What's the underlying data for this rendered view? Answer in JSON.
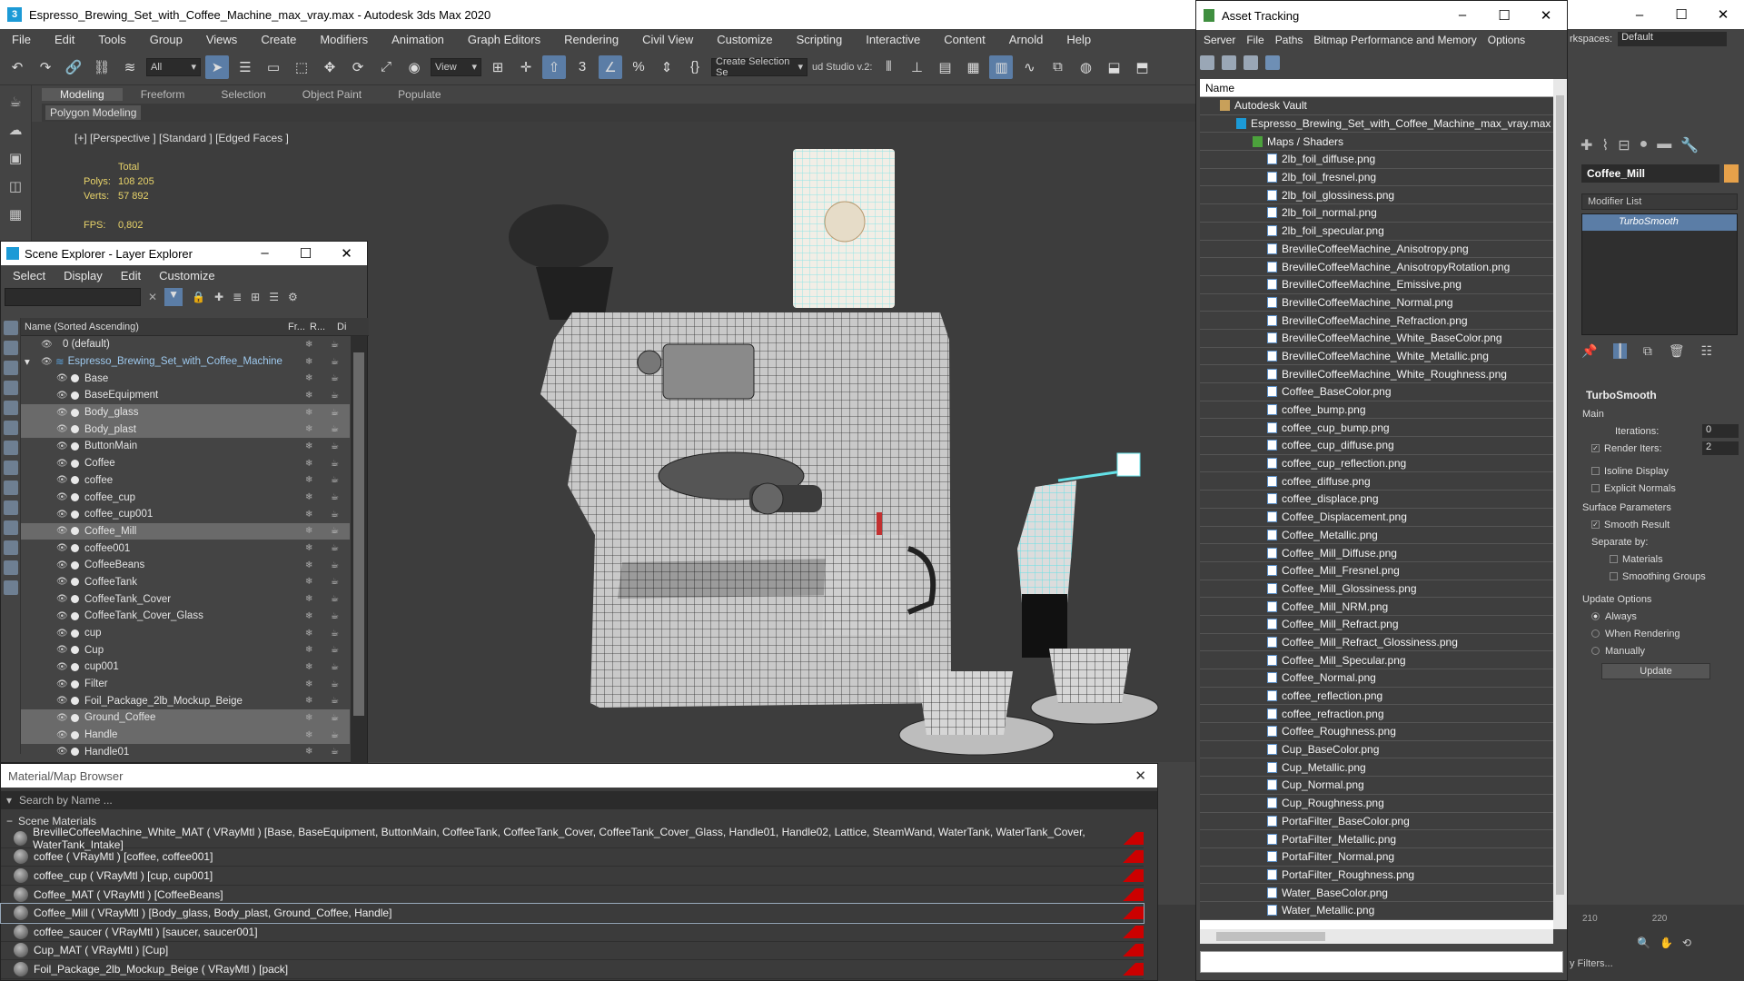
{
  "window": {
    "title": "Espresso_Brewing_Set_with_Coffee_Machine_max_vray.max - Autodesk 3ds Max 2020",
    "menu": [
      "File",
      "Edit",
      "Tools",
      "Group",
      "Views",
      "Create",
      "Modifiers",
      "Animation",
      "Graph Editors",
      "Rendering",
      "Civil View",
      "Customize",
      "Scripting",
      "Interactive",
      "Content",
      "Arnold",
      "Help"
    ]
  },
  "toolbar": {
    "selection_filter": "All",
    "ref_coord": "View",
    "named_selection": "Create Selection Se",
    "studio_label": "ud Studio v.2:"
  },
  "ribbon": {
    "tabs": [
      "Modeling",
      "Freeform",
      "Selection",
      "Object Paint",
      "Populate"
    ],
    "sub_label": "Polygon Modeling"
  },
  "viewport": {
    "label": "[+] [Perspective ] [Standard ] [Edged Faces ]",
    "stats_header": "Total",
    "polys_label": "Polys:",
    "polys_value": "108 205",
    "verts_label": "Verts:",
    "verts_value": "57 892",
    "fps_label": "FPS:",
    "fps_value": "0,802"
  },
  "scene_explorer": {
    "title": "Scene Explorer - Layer Explorer",
    "menu": [
      "Select",
      "Display",
      "Edit",
      "Customize"
    ],
    "col_name": "Name (Sorted Ascending)",
    "col_fr": "Fr...",
    "col_r": "R...",
    "col_di": "Di",
    "rows": [
      {
        "name": "0 (default)",
        "level": 0,
        "sel": false
      },
      {
        "name": "Espresso_Brewing_Set_with_Coffee_Machine",
        "level": 0,
        "sel": false,
        "accent": true
      },
      {
        "name": "Base",
        "level": 1,
        "sel": false
      },
      {
        "name": "BaseEquipment",
        "level": 1,
        "sel": false
      },
      {
        "name": "Body_glass",
        "level": 1,
        "sel": true
      },
      {
        "name": "Body_plast",
        "level": 1,
        "sel": true
      },
      {
        "name": "ButtonMain",
        "level": 1,
        "sel": false
      },
      {
        "name": "Coffee",
        "level": 1,
        "sel": false
      },
      {
        "name": "coffee",
        "level": 1,
        "sel": false
      },
      {
        "name": "coffee_cup",
        "level": 1,
        "sel": false
      },
      {
        "name": "coffee_cup001",
        "level": 1,
        "sel": false
      },
      {
        "name": "Coffee_Mill",
        "level": 1,
        "sel": true
      },
      {
        "name": "coffee001",
        "level": 1,
        "sel": false
      },
      {
        "name": "CoffeeBeans",
        "level": 1,
        "sel": false
      },
      {
        "name": "CoffeeTank",
        "level": 1,
        "sel": false
      },
      {
        "name": "CoffeeTank_Cover",
        "level": 1,
        "sel": false
      },
      {
        "name": "CoffeeTank_Cover_Glass",
        "level": 1,
        "sel": false
      },
      {
        "name": "cup",
        "level": 1,
        "sel": false
      },
      {
        "name": "Cup",
        "level": 1,
        "sel": false
      },
      {
        "name": "cup001",
        "level": 1,
        "sel": false
      },
      {
        "name": "Filter",
        "level": 1,
        "sel": false
      },
      {
        "name": "Foil_Package_2lb_Mockup_Beige",
        "level": 1,
        "sel": false
      },
      {
        "name": "Ground_Coffee",
        "level": 1,
        "sel": true
      },
      {
        "name": "Handle",
        "level": 1,
        "sel": true
      },
      {
        "name": "Handle01",
        "level": 1,
        "sel": false
      }
    ]
  },
  "material_browser": {
    "title": "Material/Map Browser",
    "search_placeholder": "Search by Name ...",
    "section": "Scene Materials",
    "rows": [
      "BrevilleCoffeeMachine_White_MAT ( VRayMtl ) [Base, BaseEquipment, ButtonMain, CoffeeTank, CoffeeTank_Cover, CoffeeTank_Cover_Glass, Handle01, Handle02, Lattice, SteamWand, WaterTank, WaterTank_Cover, WaterTank_Intake]",
      "coffee ( VRayMtl ) [coffee, coffee001]",
      "coffee_cup ( VRayMtl ) [cup, cup001]",
      "Coffee_MAT ( VRayMtl ) [CoffeeBeans]",
      "Coffee_Mill ( VRayMtl ) [Body_glass, Body_plast, Ground_Coffee, Handle]",
      "coffee_saucer ( VRayMtl ) [saucer, saucer001]",
      "Cup_MAT ( VRayMtl ) [Cup]",
      "Foil_Package_2lb_Mockup_Beige ( VRayMtl ) [pack]"
    ]
  },
  "asset_tracking": {
    "title": "Asset Tracking",
    "menu": [
      "Server",
      "File",
      "Paths",
      "Bitmap Performance and Memory",
      "Options"
    ],
    "col_name": "Name",
    "vault": "Autodesk Vault",
    "file": "Espresso_Brewing_Set_with_Coffee_Machine_max_vray.max",
    "folder": "Maps / Shaders",
    "maps": [
      "2lb_foil_diffuse.png",
      "2lb_foil_fresnel.png",
      "2lb_foil_glossiness.png",
      "2lb_foil_normal.png",
      "2lb_foil_specular.png",
      "BrevilleCoffeeMachine_Anisotropy.png",
      "BrevilleCoffeeMachine_AnisotropyRotation.png",
      "BrevilleCoffeeMachine_Emissive.png",
      "BrevilleCoffeeMachine_Normal.png",
      "BrevilleCoffeeMachine_Refraction.png",
      "BrevilleCoffeeMachine_White_BaseColor.png",
      "BrevilleCoffeeMachine_White_Metallic.png",
      "BrevilleCoffeeMachine_White_Roughness.png",
      "Coffee_BaseColor.png",
      "coffee_bump.png",
      "coffee_cup_bump.png",
      "coffee_cup_diffuse.png",
      "coffee_cup_reflection.png",
      "coffee_diffuse.png",
      "coffee_displace.png",
      "Coffee_Displacement.png",
      "Coffee_Metallic.png",
      "Coffee_Mill_Diffuse.png",
      "Coffee_Mill_Fresnel.png",
      "Coffee_Mill_Glossiness.png",
      "Coffee_Mill_NRM.png",
      "Coffee_Mill_Refract.png",
      "Coffee_Mill_Refract_Glossiness.png",
      "Coffee_Mill_Specular.png",
      "Coffee_Normal.png",
      "coffee_reflection.png",
      "coffee_refraction.png",
      "Coffee_Roughness.png",
      "Cup_BaseColor.png",
      "Cup_Metallic.png",
      "Cup_Normal.png",
      "Cup_Roughness.png",
      "PortaFilter_BaseColor.png",
      "PortaFilter_Metallic.png",
      "PortaFilter_Normal.png",
      "PortaFilter_Roughness.png",
      "Water_BaseColor.png",
      "Water_Metallic.png"
    ]
  },
  "command_panel": {
    "workspace_label": "rkspaces:",
    "workspace_value": "Default",
    "object_name": "Coffee_Mill",
    "modifier_list": "Modifier List",
    "modifier": "TurboSmooth",
    "rollout_title": "TurboSmooth",
    "main_label": "Main",
    "iterations_label": "Iterations:",
    "iterations_value": "0",
    "render_iters_label": "Render Iters:",
    "render_iters_value": "2",
    "isoline": "Isoline Display",
    "explicit_normals": "Explicit Normals",
    "surface_params": "Surface Parameters",
    "smooth_result": "Smooth Result",
    "separate_by": "Separate by:",
    "materials": "Materials",
    "smoothing_groups": "Smoothing Groups",
    "update_options": "Update Options",
    "always": "Always",
    "when_rendering": "When Rendering",
    "manually": "Manually",
    "update_button": "Update",
    "timeline_210": "210",
    "timeline_220": "220",
    "filters": "y Filters..."
  }
}
